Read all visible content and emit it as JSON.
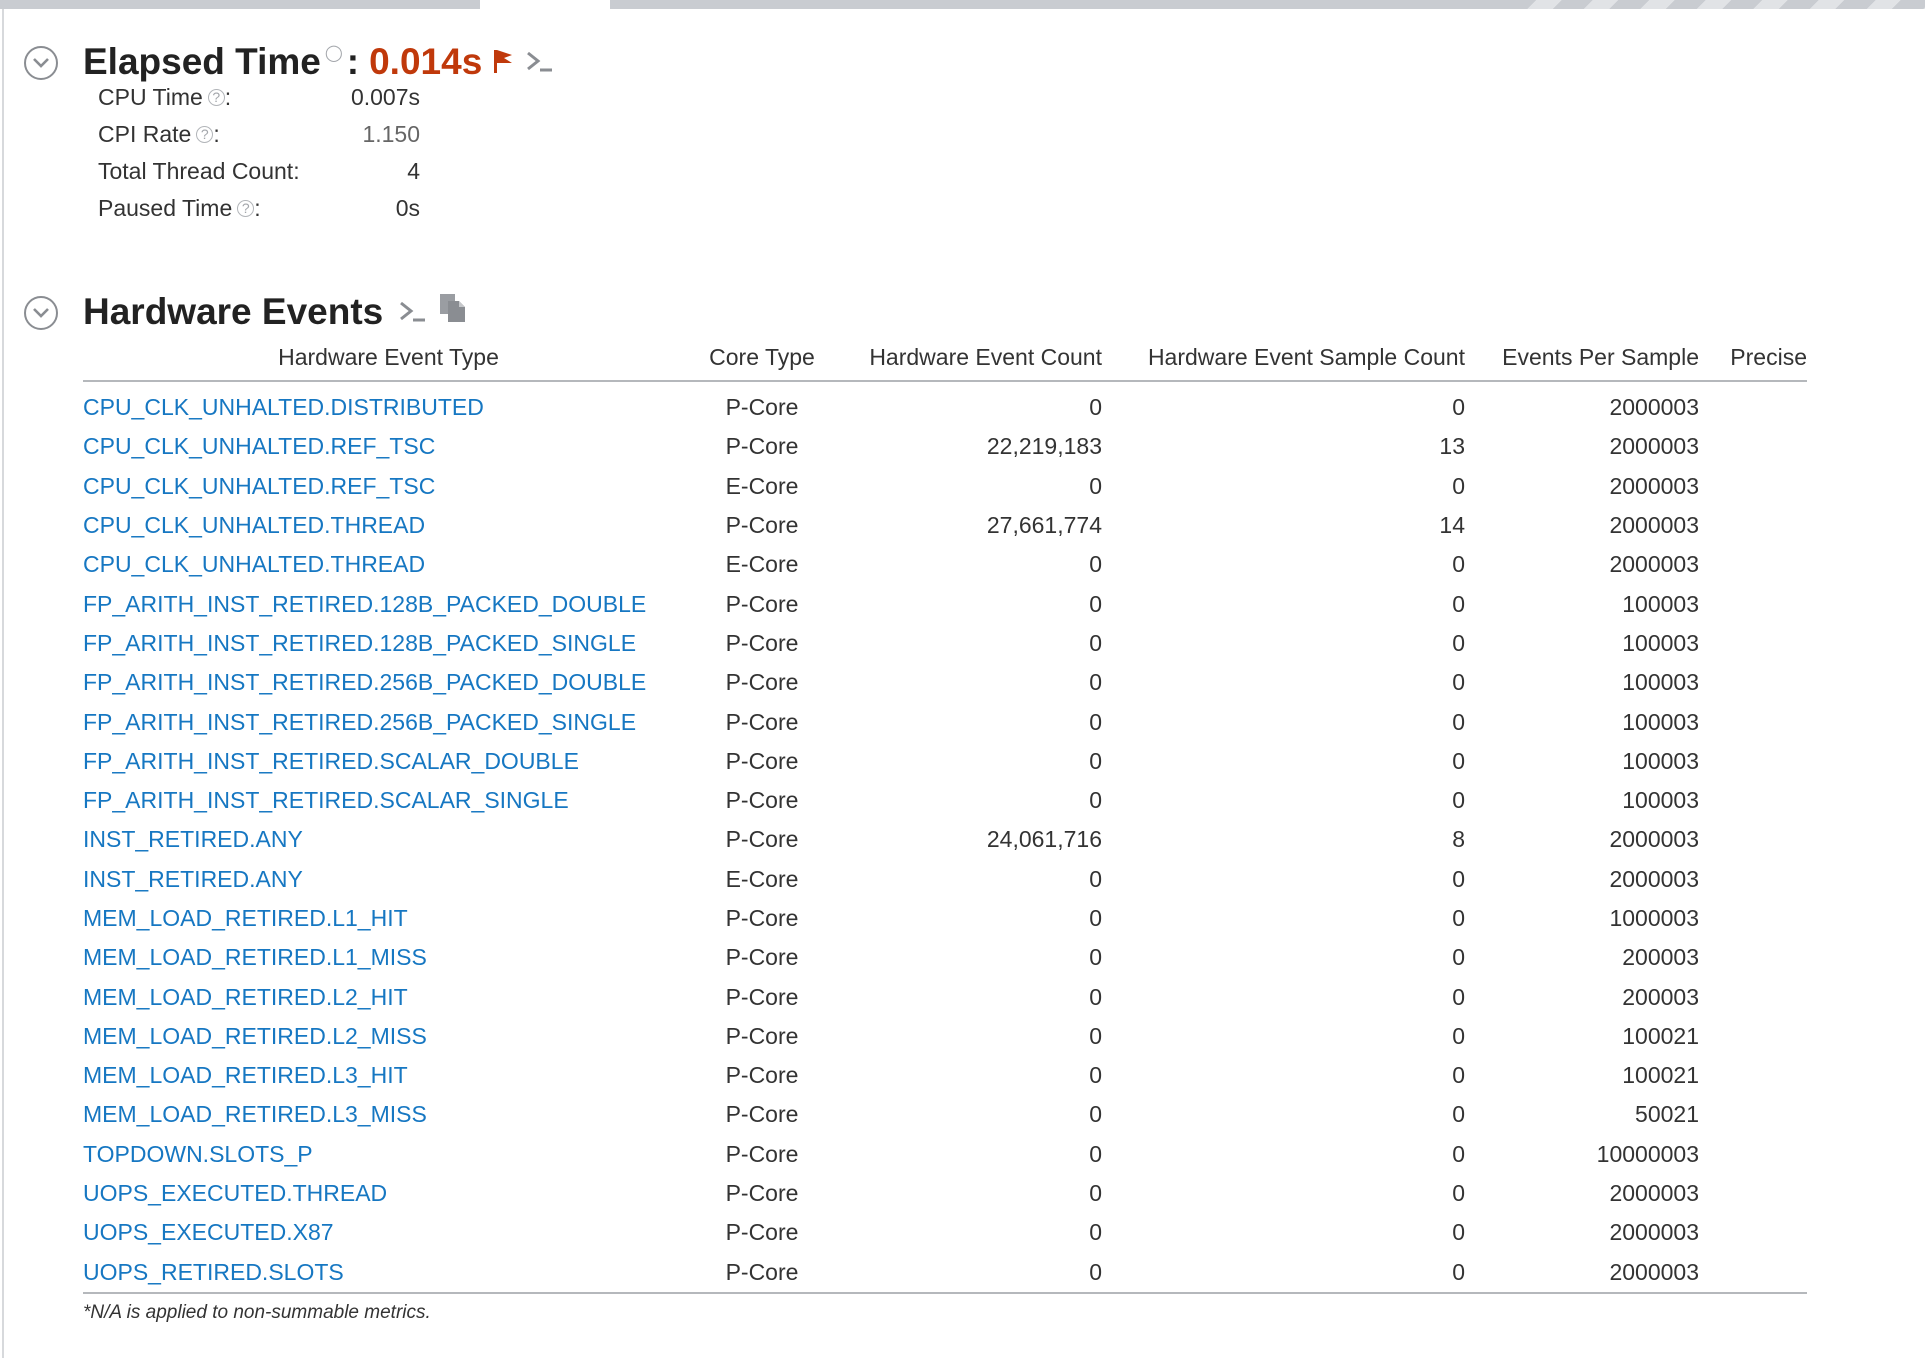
{
  "elapsed": {
    "title": "Elapsed Time",
    "help": "?",
    "colon": ":",
    "value": "0.014s",
    "metrics": [
      {
        "label": "CPU Time",
        "help": true,
        "suffix": ":",
        "value": "0.007s"
      },
      {
        "label": "CPI Rate",
        "help": true,
        "suffix": ":",
        "value": "1.150"
      },
      {
        "label": "Total Thread Count:",
        "help": false,
        "suffix": "",
        "value": "4"
      },
      {
        "label": "Paused Time",
        "help": true,
        "suffix": ":",
        "value": "0s"
      }
    ]
  },
  "hardware": {
    "title": "Hardware Events",
    "columns": [
      "Hardware Event Type",
      "Core Type",
      "Hardware Event Count",
      "Hardware Event Sample Count",
      "Events Per Sample",
      "Precise"
    ],
    "rows": [
      [
        "CPU_CLK_UNHALTED.DISTRIBUTED",
        "P-Core",
        "0",
        "0",
        "2000003",
        ""
      ],
      [
        "CPU_CLK_UNHALTED.REF_TSC",
        "P-Core",
        "22,219,183",
        "13",
        "2000003",
        ""
      ],
      [
        "CPU_CLK_UNHALTED.REF_TSC",
        "E-Core",
        "0",
        "0",
        "2000003",
        ""
      ],
      [
        "CPU_CLK_UNHALTED.THREAD",
        "P-Core",
        "27,661,774",
        "14",
        "2000003",
        ""
      ],
      [
        "CPU_CLK_UNHALTED.THREAD",
        "E-Core",
        "0",
        "0",
        "2000003",
        ""
      ],
      [
        "FP_ARITH_INST_RETIRED.128B_PACKED_DOUBLE",
        "P-Core",
        "0",
        "0",
        "100003",
        ""
      ],
      [
        "FP_ARITH_INST_RETIRED.128B_PACKED_SINGLE",
        "P-Core",
        "0",
        "0",
        "100003",
        ""
      ],
      [
        "FP_ARITH_INST_RETIRED.256B_PACKED_DOUBLE",
        "P-Core",
        "0",
        "0",
        "100003",
        ""
      ],
      [
        "FP_ARITH_INST_RETIRED.256B_PACKED_SINGLE",
        "P-Core",
        "0",
        "0",
        "100003",
        ""
      ],
      [
        "FP_ARITH_INST_RETIRED.SCALAR_DOUBLE",
        "P-Core",
        "0",
        "0",
        "100003",
        ""
      ],
      [
        "FP_ARITH_INST_RETIRED.SCALAR_SINGLE",
        "P-Core",
        "0",
        "0",
        "100003",
        ""
      ],
      [
        "INST_RETIRED.ANY",
        "P-Core",
        "24,061,716",
        "8",
        "2000003",
        ""
      ],
      [
        "INST_RETIRED.ANY",
        "E-Core",
        "0",
        "0",
        "2000003",
        ""
      ],
      [
        "MEM_LOAD_RETIRED.L1_HIT",
        "P-Core",
        "0",
        "0",
        "1000003",
        ""
      ],
      [
        "MEM_LOAD_RETIRED.L1_MISS",
        "P-Core",
        "0",
        "0",
        "200003",
        ""
      ],
      [
        "MEM_LOAD_RETIRED.L2_HIT",
        "P-Core",
        "0",
        "0",
        "200003",
        ""
      ],
      [
        "MEM_LOAD_RETIRED.L2_MISS",
        "P-Core",
        "0",
        "0",
        "100021",
        ""
      ],
      [
        "MEM_LOAD_RETIRED.L3_HIT",
        "P-Core",
        "0",
        "0",
        "100021",
        ""
      ],
      [
        "MEM_LOAD_RETIRED.L3_MISS",
        "P-Core",
        "0",
        "0",
        "50021",
        ""
      ],
      [
        "TOPDOWN.SLOTS_P",
        "P-Core",
        "0",
        "0",
        "10000003",
        ""
      ],
      [
        "UOPS_EXECUTED.THREAD",
        "P-Core",
        "0",
        "0",
        "2000003",
        ""
      ],
      [
        "UOPS_EXECUTED.X87",
        "P-Core",
        "0",
        "0",
        "2000003",
        ""
      ],
      [
        "UOPS_RETIRED.SLOTS",
        "P-Core",
        "0",
        "0",
        "2000003",
        ""
      ]
    ],
    "footnote": "*N/A is applied to non-summable metrics."
  },
  "icons": {
    "collapse": "chevron-circle-icon",
    "flag": "flag-icon",
    "terminal": "terminal-icon",
    "copy": "copy-icon",
    "help": "help-icon"
  },
  "colors": {
    "accent_value": "#c0390b",
    "link": "#1677c2",
    "icon_gray": "#8a8d92"
  }
}
